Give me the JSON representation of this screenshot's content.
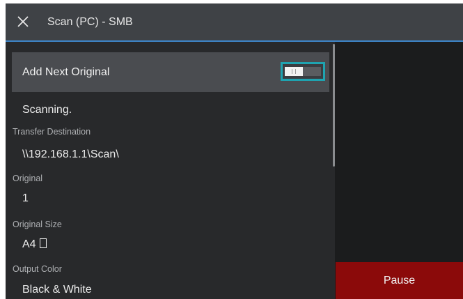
{
  "header": {
    "title": "Scan (PC) - SMB",
    "close_icon": "close-icon"
  },
  "add_next_original": {
    "label": "Add Next Original",
    "toggle_state": "off"
  },
  "status": "Scanning.",
  "fields": {
    "transfer_destination": {
      "label": "Transfer Destination",
      "value": "\\\\192.168.1.1\\Scan\\"
    },
    "original": {
      "label": "Original",
      "value": "1"
    },
    "original_size": {
      "label": "Original Size",
      "value": "A4",
      "orientation_icon": "portrait-orientation-icon"
    },
    "output_color": {
      "label": "Output Color",
      "value": "Black & White"
    }
  },
  "pause_button": {
    "label": "Pause",
    "color": "#8b0a0a"
  },
  "colors": {
    "accent_line": "#3e86c9",
    "toggle_focus": "#1fa3b0"
  }
}
